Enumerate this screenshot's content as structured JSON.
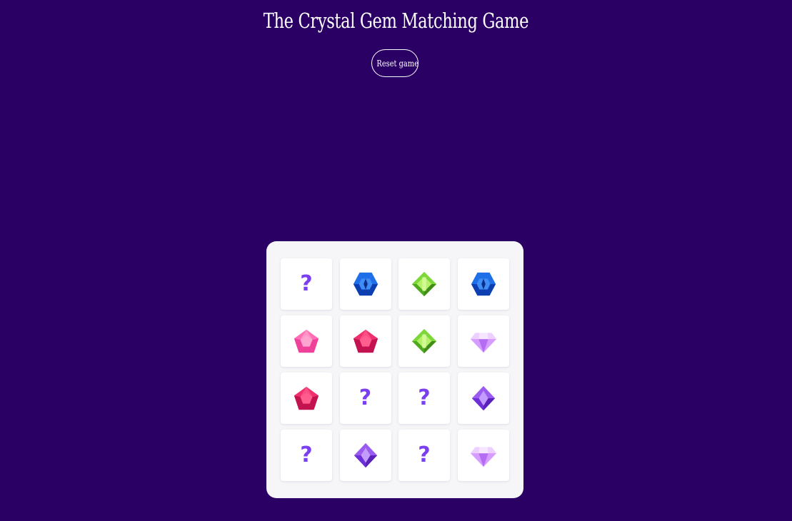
{
  "title": "The Crystal Gem Matching Game",
  "reset_label": "Reset game",
  "colors": {
    "background": "#2a0065",
    "board": "#f6f5f8",
    "card": "#ffffff",
    "question_mark": "#7b3ff2"
  },
  "board": {
    "rows": 4,
    "columns": 4,
    "cards": [
      {
        "state": "hidden",
        "label": "?",
        "icon": "question-mark-icon"
      },
      {
        "state": "revealed",
        "gem": "blue-hexagon-gem",
        "icon": "blue-gem-icon"
      },
      {
        "state": "revealed",
        "gem": "green-octagon-gem",
        "icon": "green-gem-icon"
      },
      {
        "state": "revealed",
        "gem": "blue-hexagon-gem",
        "icon": "blue-gem-icon"
      },
      {
        "state": "revealed",
        "gem": "pink-pentagon-gem",
        "icon": "pink-gem-icon"
      },
      {
        "state": "revealed",
        "gem": "red-pentagon-gem",
        "icon": "red-gem-icon"
      },
      {
        "state": "revealed",
        "gem": "green-octagon-gem",
        "icon": "green-gem-icon"
      },
      {
        "state": "revealed",
        "gem": "lilac-diamond-gem",
        "icon": "lilac-diamond-icon"
      },
      {
        "state": "revealed",
        "gem": "red-pentagon-gem",
        "icon": "red-gem-icon"
      },
      {
        "state": "hidden",
        "label": "?",
        "icon": "question-mark-icon"
      },
      {
        "state": "hidden",
        "label": "?",
        "icon": "question-mark-icon"
      },
      {
        "state": "revealed",
        "gem": "purple-rhombus-gem",
        "icon": "purple-gem-icon"
      },
      {
        "state": "hidden",
        "label": "?",
        "icon": "question-mark-icon"
      },
      {
        "state": "revealed",
        "gem": "purple-rhombus-gem",
        "icon": "purple-gem-icon"
      },
      {
        "state": "hidden",
        "label": "?",
        "icon": "question-mark-icon"
      },
      {
        "state": "revealed",
        "gem": "lilac-diamond-gem",
        "icon": "lilac-diamond-icon"
      }
    ]
  },
  "gem_colors": {
    "blue-hexagon-gem": [
      "#1f6fe8",
      "#0d3fb0",
      "#3f8df5"
    ],
    "green-octagon-gem": [
      "#7dd63a",
      "#4fa81e",
      "#b6f06a"
    ],
    "pink-pentagon-gem": [
      "#ff6fb5",
      "#f0419a",
      "#ffa3d0"
    ],
    "red-pentagon-gem": [
      "#f0306e",
      "#c2124f",
      "#ff5d8d"
    ],
    "lilac-diamond-gem": [
      "#d69cff",
      "#b56cf5",
      "#edd0ff"
    ],
    "purple-rhombus-gem": [
      "#9a5cf0",
      "#6d2fd6",
      "#c49bff"
    ]
  }
}
